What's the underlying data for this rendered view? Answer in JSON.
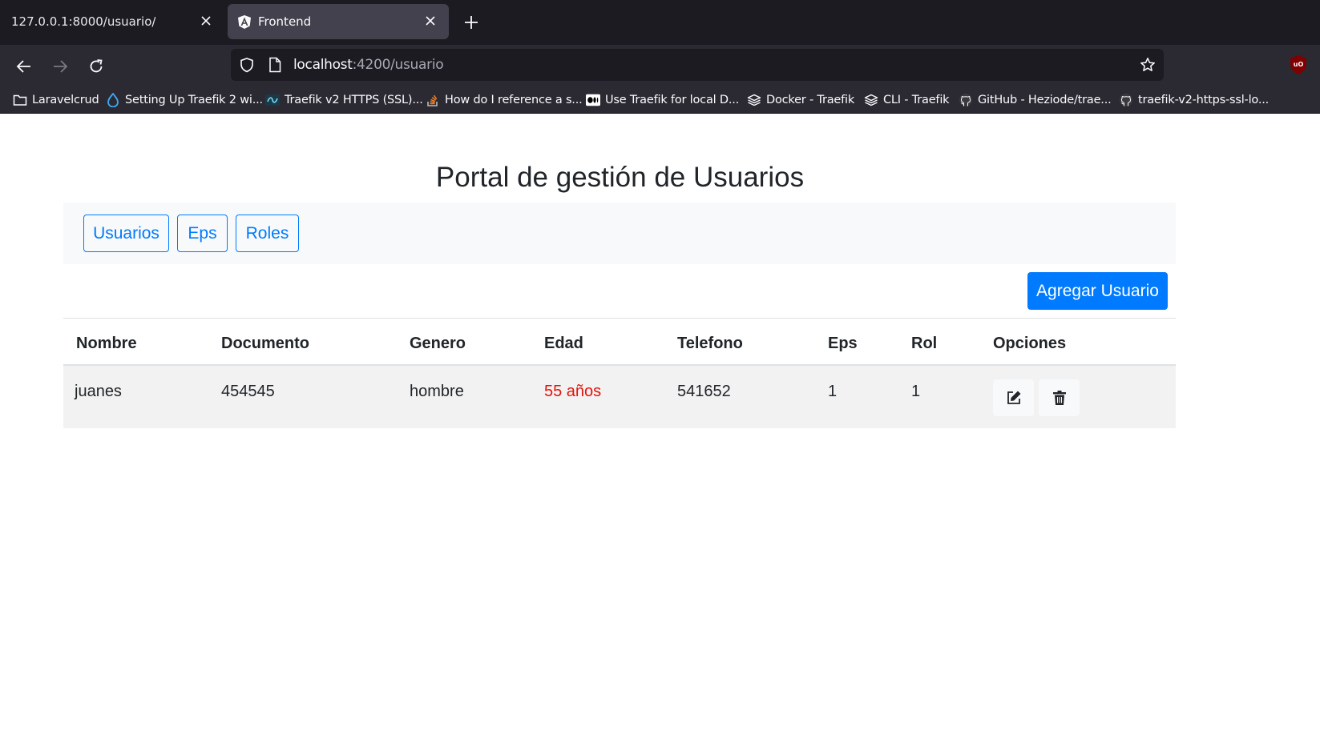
{
  "browser": {
    "tabs": [
      {
        "title": "127.0.0.1:8000/usuario/",
        "active": false
      },
      {
        "title": "Frontend",
        "active": true
      }
    ],
    "url": {
      "host": "localhost",
      "path": ":4200/usuario"
    },
    "bookmarks": [
      {
        "label": "Laravelcrud",
        "icon": "folder-icon"
      },
      {
        "label": "Setting Up Traefik 2 wi...",
        "icon": "drop-icon"
      },
      {
        "label": "Traefik v2 HTTPS (SSL)...",
        "icon": "site-icon"
      },
      {
        "label": "How do I reference a s...",
        "icon": "stackoverflow-icon"
      },
      {
        "label": "Use Traefik for local D...",
        "icon": "medium-icon"
      },
      {
        "label": "Docker - Traefik",
        "icon": "traefik-icon"
      },
      {
        "label": "CLI - Traefik",
        "icon": "traefik-icon"
      },
      {
        "label": "GitHub - Heziode/trae...",
        "icon": "github-icon"
      },
      {
        "label": "traefik-v2-https-ssl-lo...",
        "icon": "github-icon"
      }
    ]
  },
  "page": {
    "title": "Portal de gestión de Usuarios",
    "nav": {
      "usuarios": "Usuarios",
      "eps": "Eps",
      "roles": "Roles"
    },
    "add_button": "Agregar Usuario",
    "table": {
      "headers": [
        "Nombre",
        "Documento",
        "Genero",
        "Edad",
        "Telefono",
        "Eps",
        "Rol",
        "Opciones"
      ],
      "rows": [
        {
          "nombre": "juanes",
          "documento": "454545",
          "genero": "hombre",
          "edad": "55 años",
          "telefono": "541652",
          "eps": "1",
          "rol": "1"
        }
      ]
    }
  },
  "colors": {
    "primary": "#007bff",
    "age_text": "#e3120b",
    "tabbar": "#1c1b22",
    "toolbar": "#2b2a33"
  }
}
